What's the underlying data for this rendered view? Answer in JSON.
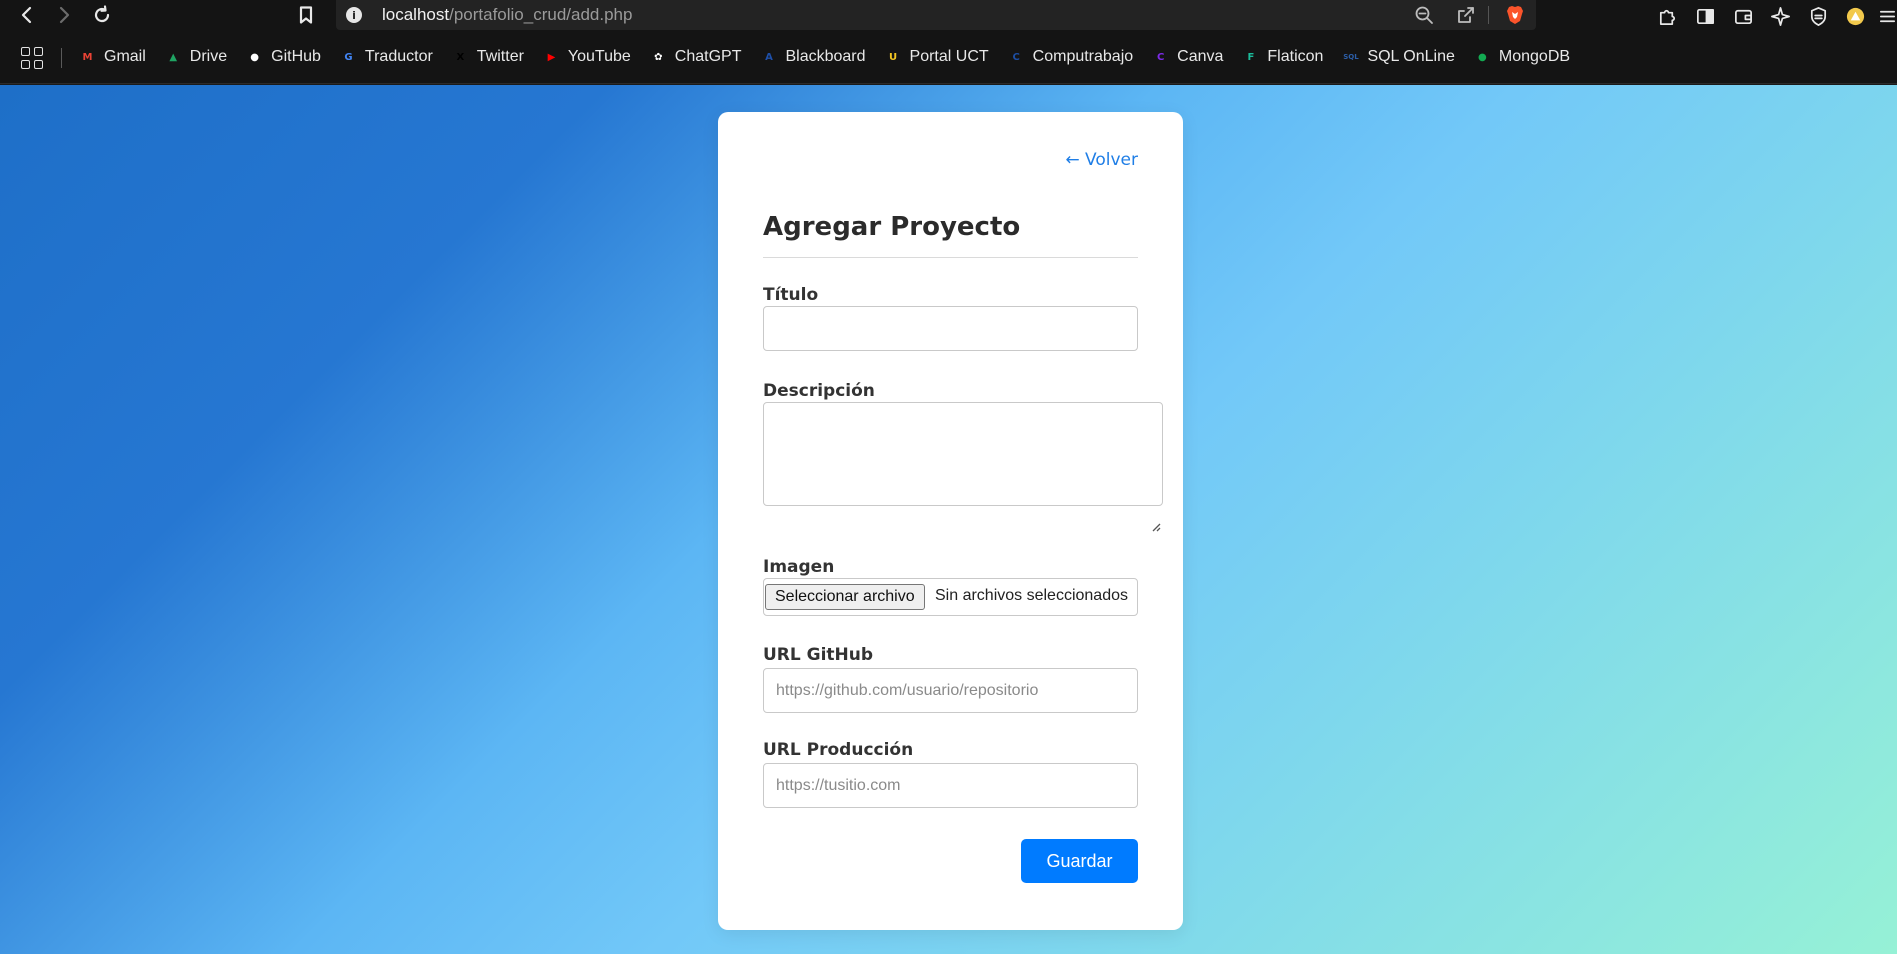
{
  "browser": {
    "url_host": "localhost",
    "url_path": "/portafolio_crud/add.php",
    "info_icon": "i",
    "bookmarks": [
      {
        "label": "Gmail",
        "icon": "gmail-icon",
        "color": "#ea4335",
        "glyph": "M"
      },
      {
        "label": "Drive",
        "icon": "drive-icon",
        "color": "#1fa463",
        "glyph": "▲"
      },
      {
        "label": "GitHub",
        "icon": "github-icon",
        "color": "#ffffff",
        "glyph": "●"
      },
      {
        "label": "Traductor",
        "icon": "translate-icon",
        "color": "#4285f4",
        "glyph": "G"
      },
      {
        "label": "Twitter",
        "icon": "x-icon",
        "color": "#000000",
        "glyph": "X"
      },
      {
        "label": "YouTube",
        "icon": "youtube-icon",
        "color": "#ff0000",
        "glyph": "▶"
      },
      {
        "label": "ChatGPT",
        "icon": "chatgpt-icon",
        "color": "#ffffff",
        "glyph": "✿"
      },
      {
        "label": "Blackboard",
        "icon": "blackboard-icon",
        "color": "#1e4fa8",
        "glyph": "A"
      },
      {
        "label": "Portal UCT",
        "icon": "uct-icon",
        "color": "#f3c623",
        "glyph": "U"
      },
      {
        "label": "Computrabajo",
        "icon": "computrabajo-icon",
        "color": "#1d4ea3",
        "glyph": "C"
      },
      {
        "label": "Canva",
        "icon": "canva-icon",
        "color": "#7d2ae8",
        "glyph": "C"
      },
      {
        "label": "Flaticon",
        "icon": "flaticon-icon",
        "color": "#1bbc9b",
        "glyph": "F"
      },
      {
        "label": "SQL OnLine",
        "icon": "sql-icon",
        "color": "#2c5ea8",
        "glyph": "SQL"
      },
      {
        "label": "MongoDB",
        "icon": "mongodb-icon",
        "color": "#13aa52",
        "glyph": "●"
      }
    ]
  },
  "form": {
    "back_label": "← Volver",
    "title": "Agregar Proyecto",
    "titulo_label": "Título",
    "titulo_value": "",
    "descripcion_label": "Descripción",
    "descripcion_value": "",
    "imagen_label": "Imagen",
    "file_button_label": "Seleccionar archivo",
    "file_status": "Sin archivos seleccionados",
    "github_label": "URL GitHub",
    "github_placeholder": "https://github.com/usuario/repositorio",
    "produccion_label": "URL Producción",
    "produccion_placeholder": "https://tusitio.com",
    "save_label": "Guardar"
  },
  "colors": {
    "accent": "#007bff",
    "link": "#1f7ee6",
    "brave": "#fb542b"
  }
}
